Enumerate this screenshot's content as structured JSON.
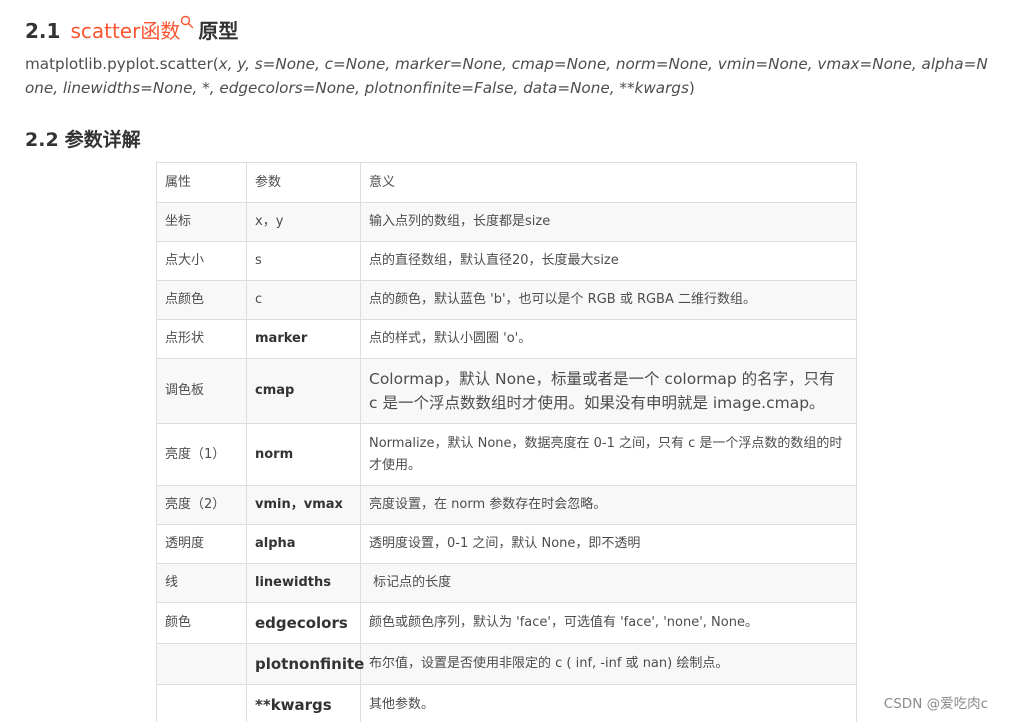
{
  "heading1": {
    "number": "2.1",
    "keyword": "scatter函数",
    "keyword_icon": "search-icon",
    "rest": "原型",
    "keyword_color": "#fc5531"
  },
  "signature": {
    "prefix": "matplotlib.pyplot.scatter(",
    "args": "x, y, s=None, c=None, marker=None, cmap=None, norm=None, vmin=None, vmax=None, alpha=None, linewidths=None, *, edgecolors=None, plotnonfinite=False, data=None, **kwargs",
    "suffix": ")"
  },
  "heading2": {
    "number": "2.2",
    "text": "参数详解"
  },
  "table": {
    "headers": [
      "属性",
      "参数",
      "意义"
    ],
    "rows": [
      {
        "attr": "坐标",
        "param": "x，y",
        "meaning": "输入点列的数组，长度都是size"
      },
      {
        "attr": "点大小",
        "param": "s",
        "meaning": "点的直径数组，默认直径20，长度最大size"
      },
      {
        "attr": "点颜色",
        "param": "c",
        "meaning": "点的颜色，默认蓝色 'b'，也可以是个 RGB 或 RGBA 二维行数组。"
      },
      {
        "attr": "点形状",
        "param": "marker",
        "meaning": "点的样式，默认小圆圈 'o'。"
      },
      {
        "attr": "调色板",
        "param": "cmap",
        "meaning": "Colormap，默认 None，标量或者是一个 colormap 的名字，只有 c 是一个浮点数数组时才使用。如果没有申明就是 image.cmap。"
      },
      {
        "attr": "亮度（1）",
        "param": "norm",
        "meaning": "Normalize，默认 None，数据亮度在 0-1 之间，只有 c 是一个浮点数的数组的时才使用。"
      },
      {
        "attr": "亮度（2）",
        "param": "vmin，vmax",
        "meaning": "亮度设置，在 norm 参数存在时会忽略。"
      },
      {
        "attr": "透明度",
        "param": "alpha",
        "meaning": "透明度设置，0-1 之间，默认 None，即不透明"
      },
      {
        "attr": "线",
        "param": "linewidths",
        "meaning": " 标记点的长度"
      },
      {
        "attr": "颜色",
        "param": "edgecolors",
        "meaning": "颜色或颜色序列，默认为 'face'，可选值有 'face', 'none', None。"
      },
      {
        "attr": "",
        "param": "plotnonfinite",
        "meaning": "布尔值，设置是否使用非限定的 c ( inf, -inf 或 nan) 绘制点。"
      },
      {
        "attr": "",
        "param": "**kwargs",
        "meaning": "其他参数。"
      }
    ]
  },
  "watermark": "CSDN @爱吃肉c"
}
